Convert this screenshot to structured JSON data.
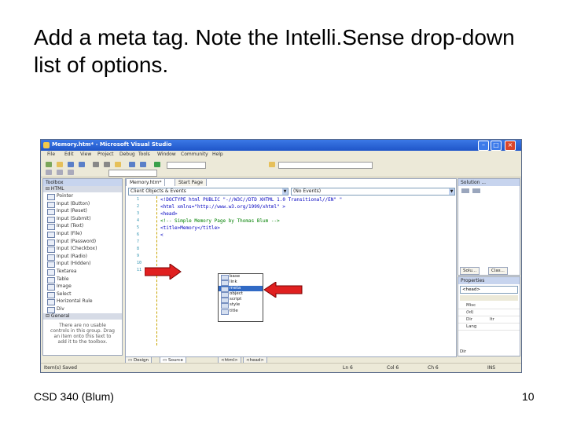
{
  "slide": {
    "title": "Add a meta tag. Note the Intelli.Sense drop-down list of options.",
    "footer_left": "CSD 340 (Blum)",
    "footer_right": "10"
  },
  "window": {
    "title": "Memory.htm* - Microsoft Visual Studio",
    "minimize_label": "–",
    "maximize_label": "□",
    "close_label": "×"
  },
  "menu": [
    "File",
    "Edit",
    "View",
    "Project",
    "Debug",
    "Tools",
    "Window",
    "Community",
    "Help"
  ],
  "toolbox": {
    "title": "Toolbox",
    "group_html": "⊟ HTML",
    "items": [
      "Pointer",
      "Input (Button)",
      "Input (Reset)",
      "Input (Submit)",
      "Input (Text)",
      "Input (File)",
      "Input (Password)",
      "Input (Checkbox)",
      "Input (Radio)",
      "Input (Hidden)",
      "Textarea",
      "Table",
      "Image",
      "Select",
      "Horizontal Rule",
      "Div"
    ],
    "group_general": "⊟ General",
    "hint": "There are no usable controls in this group. Drag an item onto this text to add it to the toolbox."
  },
  "editor": {
    "tab_active": "Memory.htm*",
    "tab_start": "Start Page",
    "left_combo": "Client Objects & Events",
    "right_combo": "(No Events)",
    "line_numbers": [
      "1",
      "2",
      "3",
      "4",
      "5",
      "6",
      "7",
      "8",
      "9",
      "10",
      "11"
    ],
    "lines": [
      "<!DOCTYPE html PUBLIC \"-//W3C//DTD XHTML 1.0 Transitional//EN\" \"",
      "<html xmlns=\"http://www.w3.org/1999/xhtml\" >",
      "<head>",
      "  <!-- Simple Memory Page by Thomas Blum -->",
      "  <title>Memory</title>",
      "  <"
    ],
    "dropdown": [
      "base",
      "link",
      "meta",
      "object",
      "script",
      "style",
      "title"
    ],
    "dropdown_selected": "meta",
    "view_design": "Design",
    "view_source": "Source",
    "crumb_1": "<html>",
    "crumb_2": "<head>"
  },
  "solution": {
    "title": "Solution ...",
    "tab_solution": "Solu...",
    "tab_class": "Clas..."
  },
  "properties": {
    "title": "Properties",
    "object": "<head>",
    "rows": [
      "Misc",
      "(Id)",
      "Dir",
      "Lang"
    ],
    "value_dir": "ltr",
    "footer": "Dir"
  },
  "status": {
    "left": "Item(s) Saved",
    "ln": "Ln 6",
    "col": "Col 6",
    "ch": "Ch 6",
    "mode": "INS"
  },
  "colors": {
    "accent": "#316ac5",
    "arrow": "#e02020",
    "titlebar": "#1f55c8"
  }
}
